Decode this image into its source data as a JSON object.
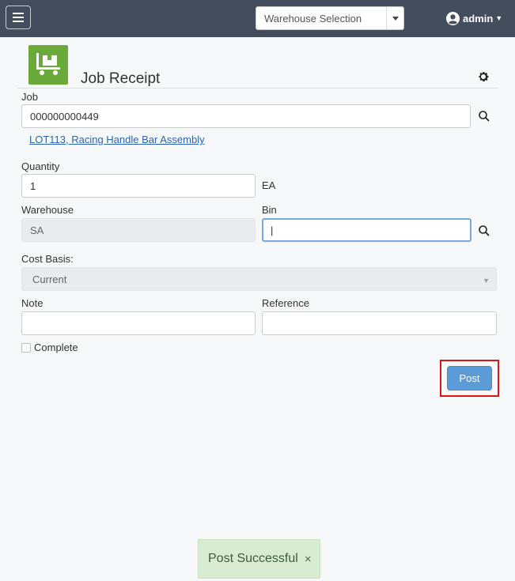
{
  "topbar": {
    "menu_icon": "hamburger-menu-icon",
    "warehouse_select": "Warehouse Selection",
    "user": "admin"
  },
  "page": {
    "title": "Job Receipt",
    "app_icon": "pallet-cart-icon",
    "settings_icon": "gear-icon"
  },
  "form": {
    "job_label": "Job",
    "job_value": "000000000449",
    "job_link": "LOT113, Racing Handle Bar Assembly",
    "quantity_label": "Quantity",
    "quantity_value": "1",
    "uom": "EA",
    "warehouse_label": "Warehouse",
    "warehouse_value": "SA",
    "bin_label": "Bin",
    "bin_value": "|",
    "cost_basis_label": "Cost Basis:",
    "cost_basis_value": "Current",
    "note_label": "Note",
    "note_value": "",
    "reference_label": "Reference",
    "reference_value": "",
    "complete_label": "Complete",
    "complete_checked": false
  },
  "actions": {
    "post_label": "Post"
  },
  "toast": {
    "message": "Post Successful",
    "close": "×"
  },
  "colors": {
    "topbar": "#434d5d",
    "accent_green": "#6aaa3a",
    "post_button": "#5b9bd8",
    "highlight_red": "#d8141b",
    "toast_bg": "#d9ecd2"
  }
}
